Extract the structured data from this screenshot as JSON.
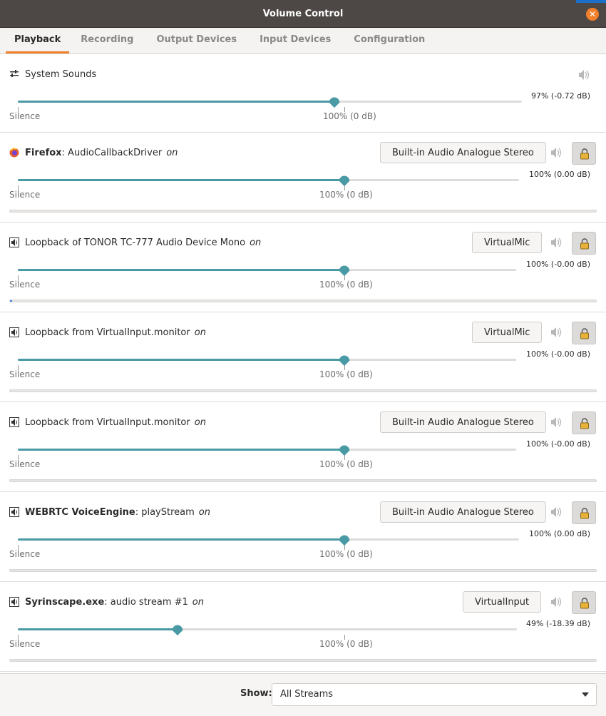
{
  "window": {
    "title": "Volume Control",
    "close_glyph": "✕"
  },
  "tabs": [
    {
      "label": "Playback"
    },
    {
      "label": "Recording"
    },
    {
      "label": "Output Devices"
    },
    {
      "label": "Input Devices"
    },
    {
      "label": "Configuration"
    }
  ],
  "system_sounds": {
    "name": "System Sounds",
    "level_pct": 97,
    "level_text": "97% (-0.72 dB)",
    "silence_label": "Silence",
    "unity_label": "100% (0 dB)"
  },
  "streams": [
    {
      "app_bold": "Firefox",
      "app_rest": ": AudioCallbackDriver",
      "state": "on",
      "device": "Built-in Audio Analogue Stereo",
      "level_pct": 100,
      "level_text": "100% (0.00 dB)",
      "silence_label": "Silence",
      "unity_label": "100% (0 dB)",
      "meter": 0,
      "icon": "firefox-icon"
    },
    {
      "app_bold": "",
      "app_rest": "Loopback of TONOR TC-777 Audio Device Mono",
      "state": "on",
      "device": "VirtualMic",
      "level_pct": 100,
      "level_text": "100% (-0.00 dB)",
      "silence_label": "Silence",
      "unity_label": "100% (0 dB)",
      "meter": 0.004,
      "icon": "speaker-icon"
    },
    {
      "app_bold": "",
      "app_rest": "Loopback from VirtualInput.monitor",
      "state": "on",
      "device": "VirtualMic",
      "level_pct": 100,
      "level_text": "100% (-0.00 dB)",
      "silence_label": "Silence",
      "unity_label": "100% (0 dB)",
      "meter": 0,
      "icon": "speaker-icon"
    },
    {
      "app_bold": "",
      "app_rest": "Loopback from VirtualInput.monitor",
      "state": "on",
      "device": "Built-in Audio Analogue Stereo",
      "level_pct": 100,
      "level_text": "100% (-0.00 dB)",
      "silence_label": "Silence",
      "unity_label": "100% (0 dB)",
      "meter": 0,
      "icon": "speaker-icon"
    },
    {
      "app_bold": "WEBRTC VoiceEngine",
      "app_rest": ": playStream",
      "state": "on",
      "device": "Built-in Audio Analogue Stereo",
      "level_pct": 100,
      "level_text": "100% (0.00 dB)",
      "silence_label": "Silence",
      "unity_label": "100% (0 dB)",
      "meter": 0,
      "icon": "speaker-icon"
    },
    {
      "app_bold": "Syrinscape.exe",
      "app_rest": ": audio stream #1",
      "state": "on",
      "device": "VirtualInput",
      "level_pct": 49,
      "level_text": "49% (-18.39 dB)",
      "silence_label": "Silence",
      "unity_label": "100% (0 dB)",
      "meter": 0,
      "icon": "speaker-icon"
    }
  ],
  "footer": {
    "show_label": "Show:",
    "show_value": "All Streams"
  },
  "colors": {
    "accent": "#f0802b",
    "slider": "#4a9aa5",
    "titlebar": "#4d4845"
  }
}
